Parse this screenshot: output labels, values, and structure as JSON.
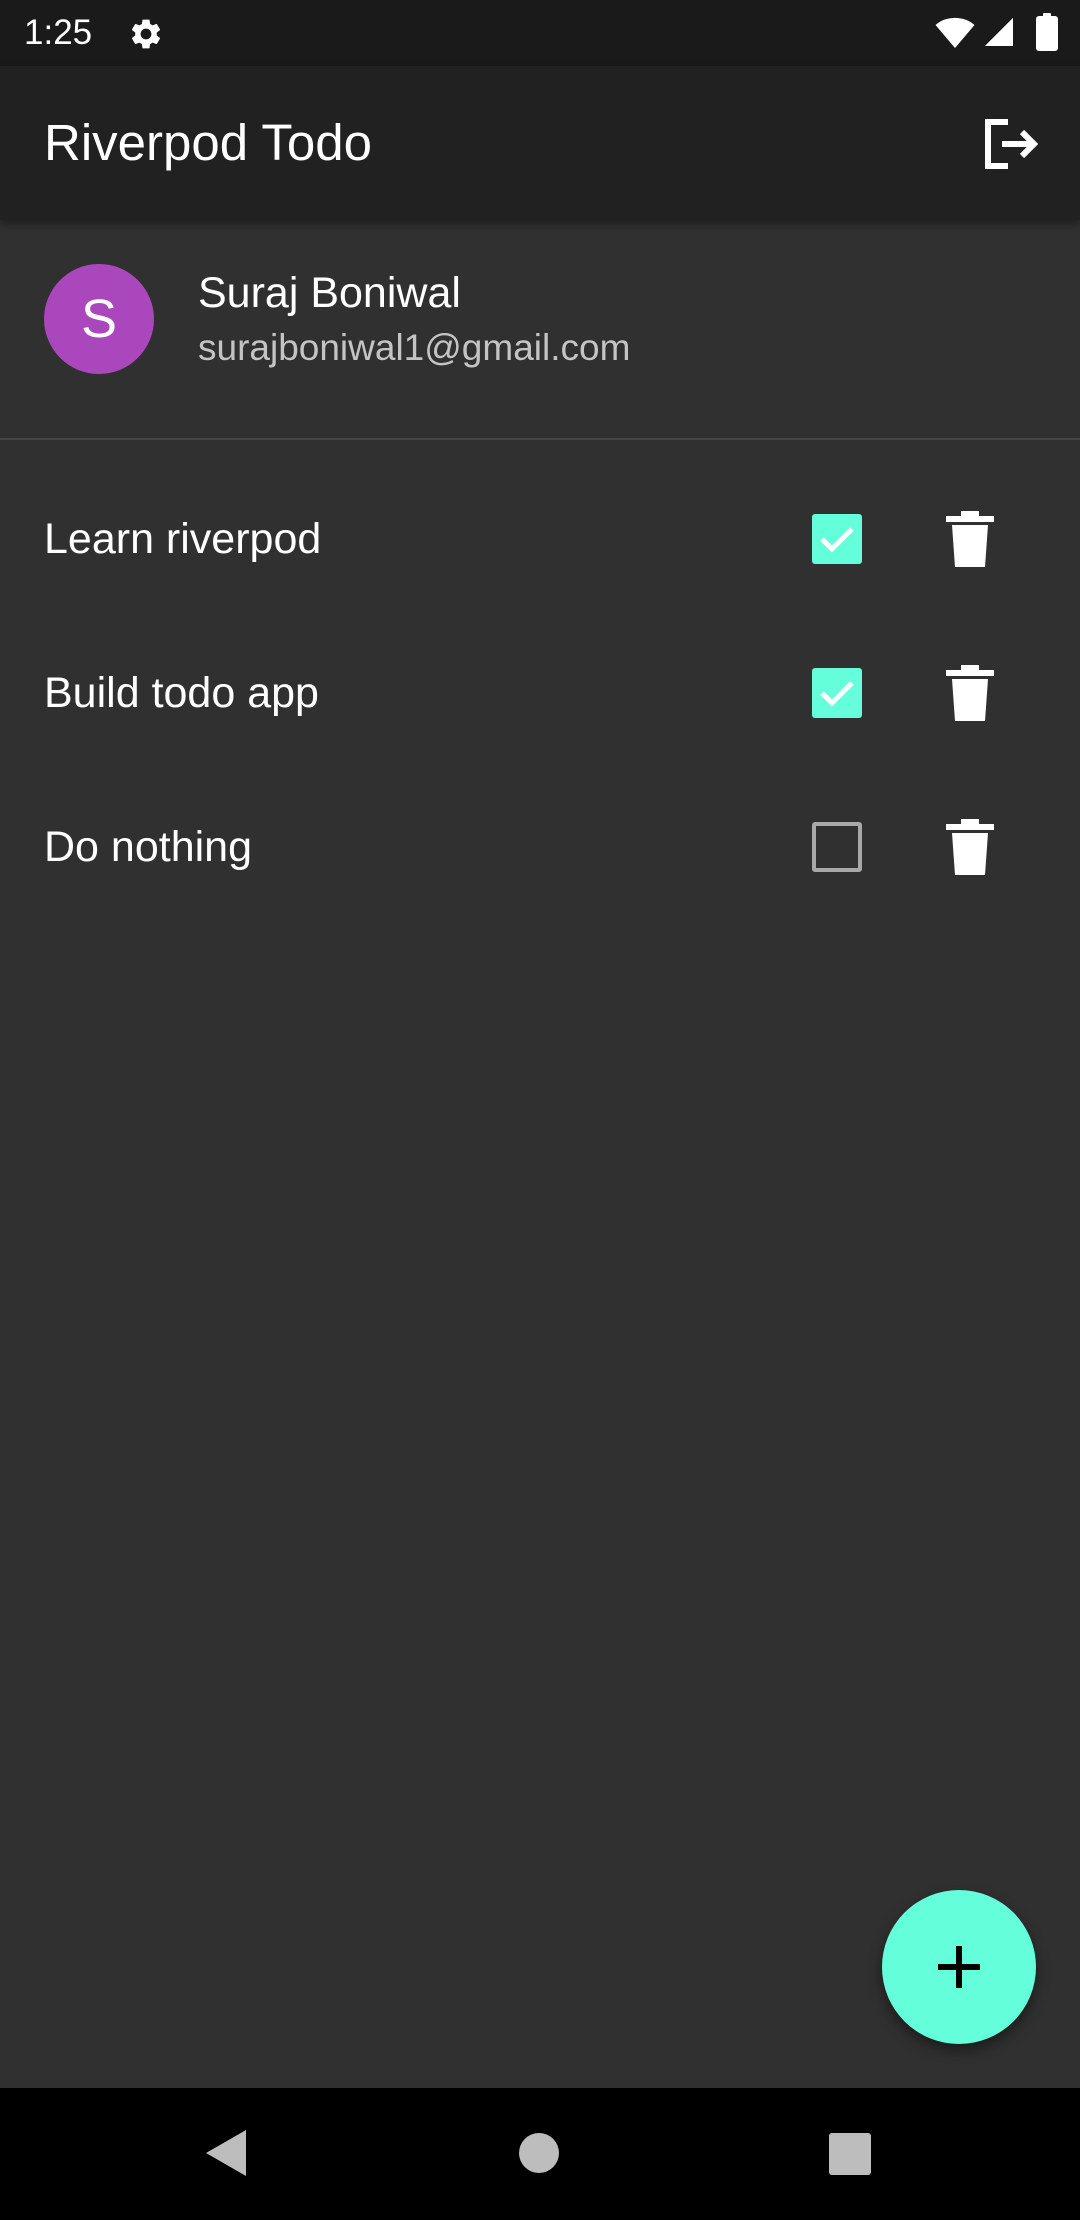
{
  "status_bar": {
    "time": "1:25",
    "icons": [
      "gear-icon",
      "wifi-icon",
      "signal-icon",
      "battery-icon"
    ]
  },
  "app_bar": {
    "title": "Riverpod Todo",
    "action_icon": "logout-icon"
  },
  "profile": {
    "initial": "S",
    "name": "Suraj Boniwal",
    "email": "surajboniwal1@gmail.com",
    "avatar_color": "#ab47bc"
  },
  "todos": [
    {
      "label": "Learn riverpod",
      "checked": true
    },
    {
      "label": "Build todo app",
      "checked": true
    },
    {
      "label": "Do nothing",
      "checked": false
    }
  ],
  "fab": {
    "icon": "plus-icon"
  },
  "colors": {
    "accent": "#64ffda",
    "background": "#303030",
    "app_bar": "#212121",
    "status_bar": "#1a1a1a"
  },
  "nav_bar": {
    "icons": [
      "back-icon",
      "home-icon",
      "recents-icon"
    ]
  }
}
